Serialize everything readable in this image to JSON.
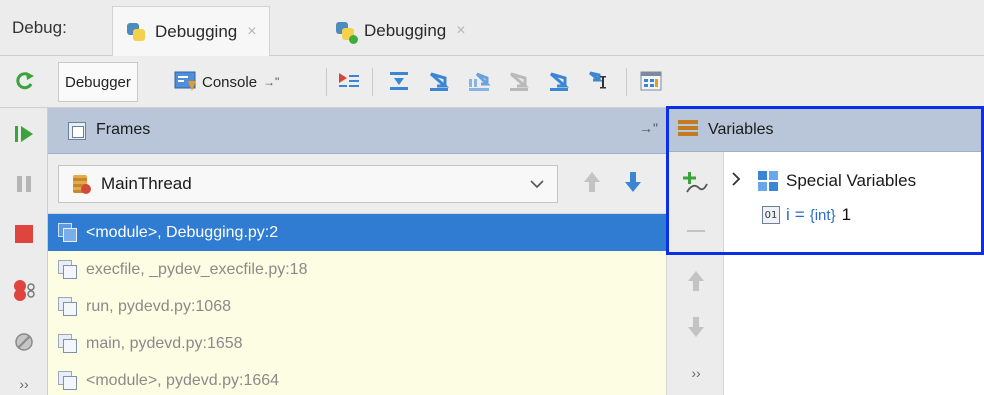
{
  "window": {
    "debug_label": "Debug:",
    "tabs": [
      {
        "label": "Debugging",
        "close": "×",
        "active": true
      },
      {
        "label": "Debugging",
        "close": "×",
        "active": false
      }
    ]
  },
  "toolbar": {
    "debugger_tab": "Debugger",
    "console_tab": "Console",
    "console_pin": "→\""
  },
  "frames": {
    "title": "Frames",
    "pin": "→\"",
    "thread": "MainThread",
    "items": [
      {
        "label": "<module>, Debugging.py:2",
        "selected": true
      },
      {
        "label": "execfile, _pydev_execfile.py:18",
        "selected": false
      },
      {
        "label": "run, pydevd.py:1068",
        "selected": false
      },
      {
        "label": "main, pydevd.py:1658",
        "selected": false
      },
      {
        "label": "<module>, pydevd.py:1664",
        "selected": false
      }
    ]
  },
  "variables": {
    "title": "Variables",
    "special": "Special Variables",
    "var": {
      "name": "i",
      "eq": "=",
      "type": "{int}",
      "value": "1"
    }
  },
  "colors": {
    "selection": "#2f7cd2",
    "header": "#b9c6d9",
    "highlight_box": "#0a2fe6",
    "frames_bg": "#fdfde3"
  }
}
